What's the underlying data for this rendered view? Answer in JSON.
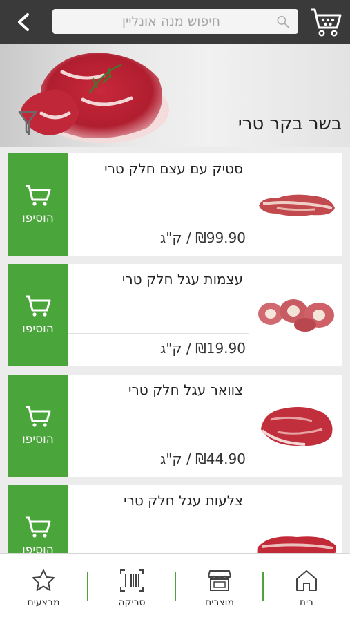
{
  "header": {
    "search_placeholder": "חיפוש מנה אונליין"
  },
  "hero": {
    "title": "בשר בקר טרי"
  },
  "products": [
    {
      "name": "סטיק עם עצם חלק טרי",
      "price": "₪99.90 / ק\"ג",
      "add_label": "הוסיפו"
    },
    {
      "name": "עצמות עגל חלק טרי",
      "price": "₪19.90 / ק\"ג",
      "add_label": "הוסיפו"
    },
    {
      "name": "צוואר עגל חלק טרי",
      "price": "₪44.90 / ק\"ג",
      "add_label": "הוסיפו"
    },
    {
      "name": "צלעות עגל חלק טרי",
      "price": "",
      "add_label": "הוסיפו"
    }
  ],
  "bottom_nav": {
    "items": [
      {
        "label": "מבצעים",
        "icon": "star-icon"
      },
      {
        "label": "סריקה",
        "icon": "barcode-icon"
      },
      {
        "label": "מוצרים",
        "icon": "store-icon"
      },
      {
        "label": "בית",
        "icon": "home-icon"
      }
    ]
  },
  "colors": {
    "topbar": "#3a3a3a",
    "accent_green": "#4aa53a",
    "background": "#ececec"
  }
}
